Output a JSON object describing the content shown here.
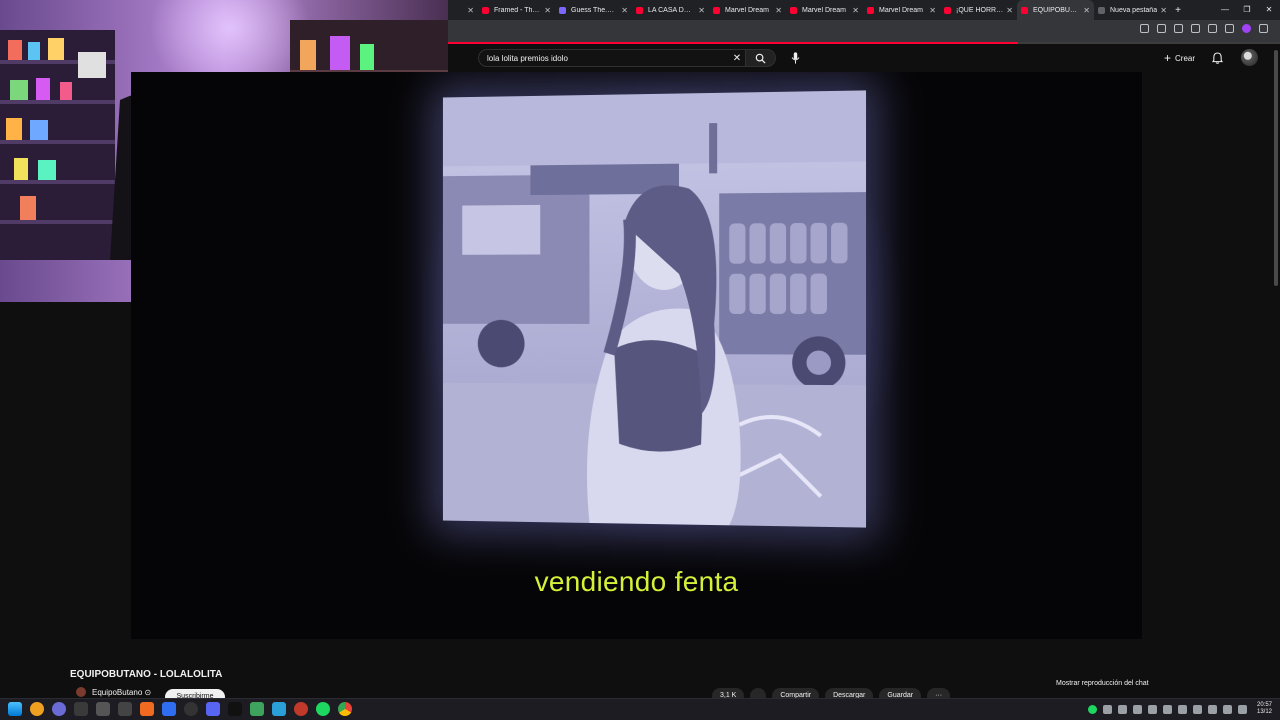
{
  "browser": {
    "tabs": [
      {
        "title": "",
        "color": "#202124",
        "active": false
      },
      {
        "title": "Framed - The d",
        "color": "#ff0033",
        "active": false
      },
      {
        "title": "Guess The.Gam",
        "color": "#7a68ff",
        "active": false
      },
      {
        "title": "LA CASA DE LO",
        "color": "#ff0033",
        "active": false
      },
      {
        "title": "Marvel Dream",
        "color": "#ff0033",
        "active": false
      },
      {
        "title": "Marvel Dream",
        "color": "#ff0033",
        "active": false
      },
      {
        "title": "Marvel Dream",
        "color": "#ff0033",
        "active": false
      },
      {
        "title": "¡QUE HORROR",
        "color": "#ff0033",
        "active": false
      },
      {
        "title": "EQUIPOBUTAN",
        "color": "#ff0033",
        "active": true
      },
      {
        "title": "Nueva pestaña",
        "color": "#5f6368",
        "active": false
      }
    ],
    "new_tab_icon": "plus-icon",
    "window_controls": [
      "—",
      "❐",
      "✕"
    ]
  },
  "youtube": {
    "search": {
      "value": "lola lolita premios idolo",
      "clear": "✕"
    },
    "create_label": "Crear",
    "player": {
      "subtitle": "vendiendo fenta"
    },
    "video_title": "EQUIPOBUTANO - LOLALOLITA",
    "channel_name": "EquipoButano ⊙",
    "subscribe_label": "Suscribirme",
    "actions": [
      "3,1 K",
      "",
      "Compartir",
      "Descargar",
      "Guardar",
      "···"
    ],
    "chat_replay_label": "Mostrar reproducción del chat"
  },
  "taskbar": {
    "time": "20:57",
    "date": "13/12",
    "colors": {
      "accent": "#1ed760",
      "windows": "#4cc2ff"
    }
  }
}
